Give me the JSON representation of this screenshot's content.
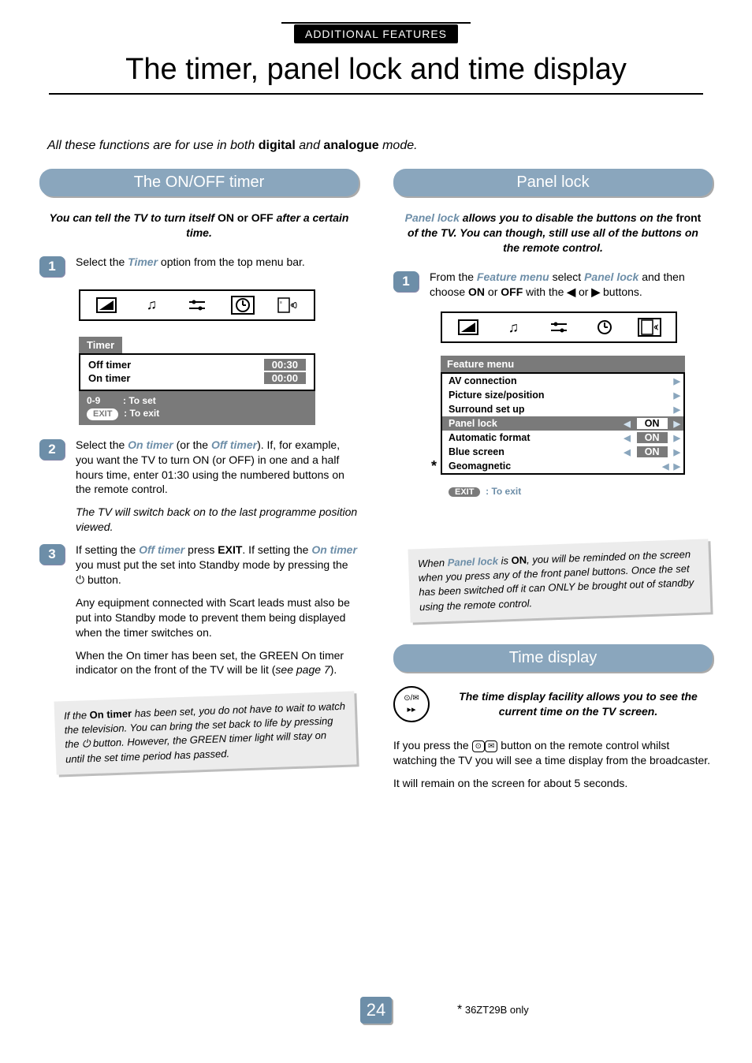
{
  "header": {
    "badge": "ADDITIONAL FEATURES",
    "title": "The timer, panel lock and time display"
  },
  "intro": {
    "prefix": "All these functions are for use in both ",
    "b1": "digital",
    "mid": " and ",
    "b2": "analogue",
    "suffix": " mode."
  },
  "left": {
    "section_title": "The ON/OFF timer",
    "blurb_prefix": "You can tell the TV to turn itself ",
    "blurb_b1": "ON or OFF",
    "blurb_suffix": " after a certain time.",
    "step1_badge": "1",
    "step1_a": "Select the ",
    "step1_accent": "Timer",
    "step1_b": " option from the top menu bar.",
    "osd": {
      "title": "Timer",
      "row1_label": "Off timer",
      "row1_val": "00:30",
      "row2_label": "On timer",
      "row2_val": "00:00",
      "help1_key": "0-9",
      "help1_txt": ":  To set",
      "help2_key": "EXIT",
      "help2_txt": ":  To exit"
    },
    "step2_badge": "2",
    "step2_a": "Select the ",
    "step2_accent1": "On timer",
    "step2_b": " (or the ",
    "step2_accent2": "Off timer",
    "step2_c": "). If, for example, you want the TV to turn ON (or OFF) in one and a half hours time, enter 01:30 using the numbered buttons on the remote control.",
    "step2_note": "The TV will switch back on to the last programme position viewed.",
    "step3_badge": "3",
    "step3_a": "If setting the ",
    "step3_accent1": "Off timer",
    "step3_b": " press ",
    "step3_bold1": "EXIT",
    "step3_c": ". If setting the ",
    "step3_accent2": "On timer",
    "step3_d": " you must put the set into Standby mode by pressing the ",
    "step3_e": " button.",
    "para2": "Any equipment connected with Scart leads must also be put into Standby mode to prevent them being displayed when the timer switches on.",
    "para3_a": "When the ",
    "para3_accent": "On timer",
    "para3_b": " has been set, the GREEN On timer indicator on the front of the TV will be lit (",
    "para3_ital": "see page 7",
    "para3_c": ").",
    "card_a": "If the ",
    "card_b": "On timer",
    "card_c": " has been set, you do not have to wait to watch the television. You can bring the set back to life by pressing the ",
    "card_d": " button. However, the GREEN timer light will stay on until the set time period has passed."
  },
  "right": {
    "section_title": "Panel lock",
    "blurb_accent": "Panel lock",
    "blurb_a": " allows you to disable the buttons on the ",
    "blurb_b": "front",
    "blurb_c": " of the TV. You can though, still use all of the buttons on the remote control.",
    "step1_badge": "1",
    "step1_a": "From the ",
    "step1_accent1": "Feature menu",
    "step1_b": " select ",
    "step1_accent2": "Panel lock",
    "step1_c": " and then choose ",
    "step1_bold1": "ON",
    "step1_d": " or ",
    "step1_bold2": "OFF",
    "step1_e": " with the ",
    "step1_f": " or ",
    "step1_g": " buttons.",
    "fm": {
      "title": "Feature menu",
      "rows": [
        {
          "label": "AV connection",
          "arrows": "r"
        },
        {
          "label": "Picture size/position",
          "arrows": "r"
        },
        {
          "label": "Surround set up",
          "arrows": "r"
        },
        {
          "label": "Panel lock",
          "value": "ON",
          "arrows": "lr",
          "selected": true
        },
        {
          "label": "Automatic format",
          "value": "ON",
          "arrows": "lr"
        },
        {
          "label": "Blue screen",
          "value": "ON",
          "arrows": "lr"
        },
        {
          "label": "Geomagnetic",
          "arrows": "lr",
          "star": true
        }
      ],
      "help_key": "EXIT",
      "help_txt": ":  To exit"
    },
    "card_a": "When ",
    "card_accent": "Panel lock",
    "card_b": " is ",
    "card_bold": "ON",
    "card_c": ", you will be reminded on the screen when you press any of the front panel buttons. Once the set has been switched off it can ONLY be brought out of standby using the remote control.",
    "time_section_title": "Time display",
    "time_blurb": "The time display facility allows you to see the current time on the TV screen.",
    "time_p1_a": "If you press the ",
    "time_p1_b": " button on the remote control whilst watching the TV you will see a time display from the broadcaster.",
    "time_p2": "It will remain on the screen for about 5 seconds."
  },
  "footer": {
    "page": "24",
    "note": " 36ZT29B only",
    "star": "*"
  },
  "icons": {
    "picture": "◢",
    "music": "♫",
    "sliders": "⟊",
    "clock": "◷",
    "speaker": "🕪",
    "power": "⏻",
    "tri_l": "◀",
    "tri_r": "▶",
    "play": "▸▸",
    "clock_txt": "⌚/✉"
  }
}
